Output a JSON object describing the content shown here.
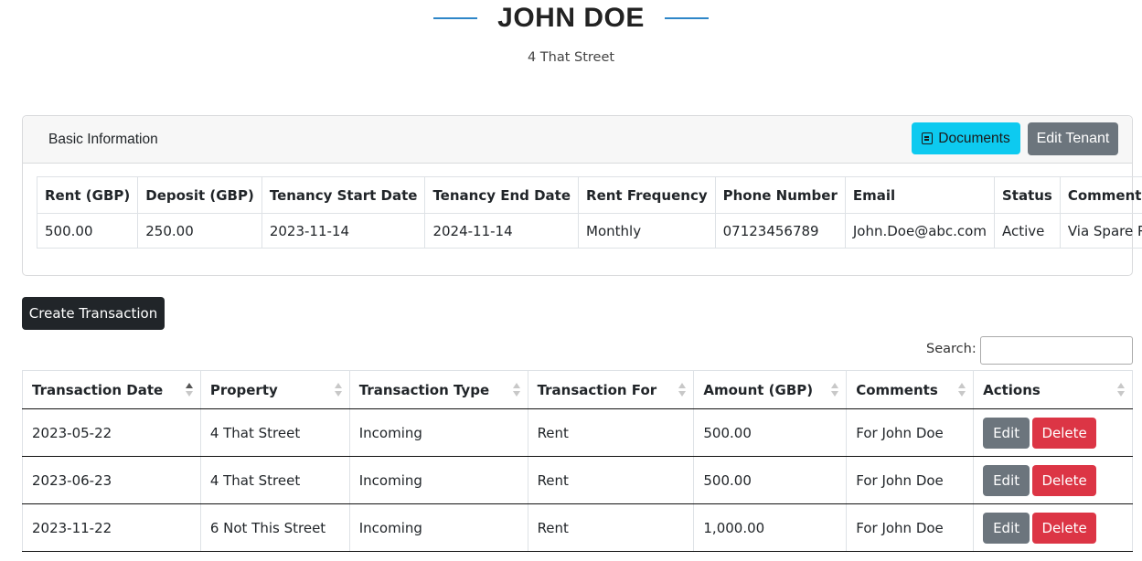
{
  "header": {
    "tenant_name": "JOHN DOE",
    "address": "4 That Street"
  },
  "colors": {
    "accent_line": "#2e86c8",
    "documents_button": "#0dcaf0",
    "secondary_button": "#6c757d",
    "danger_button": "#dc3545",
    "dark_button": "#212529"
  },
  "basic_info": {
    "title": "Basic Information",
    "documents_label": "Documents",
    "documents_icon": "document-edit-icon",
    "edit_tenant_label": "Edit Tenant",
    "columns": [
      "Rent (GBP)",
      "Deposit (GBP)",
      "Tenancy Start Date",
      "Tenancy End Date",
      "Rent Frequency",
      "Phone Number",
      "Email",
      "Status",
      "Comments"
    ],
    "row": [
      "500.00",
      "250.00",
      "2023-11-14",
      "2024-11-14",
      "Monthly",
      "07123456789",
      "John.Doe@abc.com",
      "Active",
      "Via Spare Room"
    ]
  },
  "create_transaction_label": "Create Transaction",
  "search": {
    "label": "Search:",
    "value": ""
  },
  "transactions": {
    "columns": [
      "Transaction Date",
      "Property",
      "Transaction Type",
      "Transaction For",
      "Amount (GBP)",
      "Comments",
      "Actions"
    ],
    "sorted_column": "Transaction Date",
    "sort_direction": "ascending",
    "edit_label": "Edit",
    "delete_label": "Delete",
    "rows": [
      [
        "2023-05-22",
        "4 That Street",
        "Incoming",
        "Rent",
        "500.00",
        "For John Doe"
      ],
      [
        "2023-06-23",
        "4 That Street",
        "Incoming",
        "Rent",
        "500.00",
        "For John Doe"
      ],
      [
        "2023-11-22",
        "6 Not This Street",
        "Incoming",
        "Rent",
        "1,000.00",
        "For John Doe"
      ]
    ]
  }
}
